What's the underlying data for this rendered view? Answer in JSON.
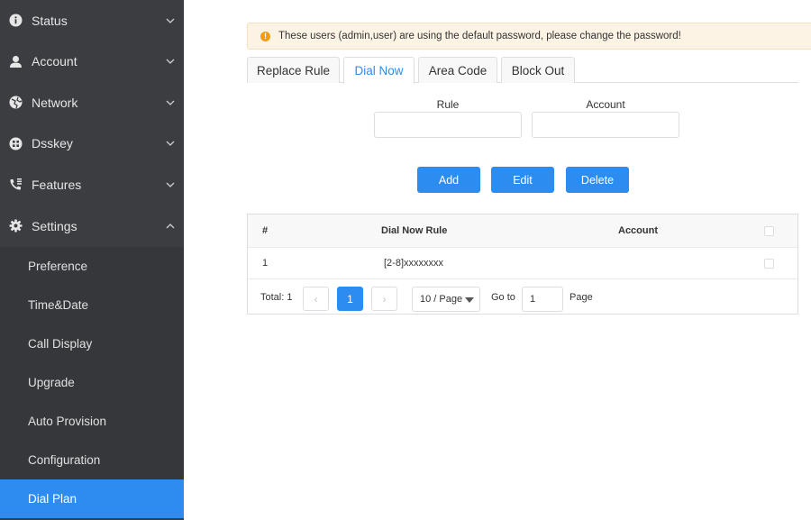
{
  "sidebar": {
    "items": [
      {
        "label": "Status",
        "icon": "info-icon"
      },
      {
        "label": "Account",
        "icon": "user-icon"
      },
      {
        "label": "Network",
        "icon": "globe-icon"
      },
      {
        "label": "Dsskey",
        "icon": "grid-icon"
      },
      {
        "label": "Features",
        "icon": "phone-icon"
      },
      {
        "label": "Settings",
        "icon": "gear-icon"
      }
    ],
    "sub_items": [
      "Preference",
      "Time&Date",
      "Call Display",
      "Upgrade",
      "Auto Provision",
      "Configuration",
      "Dial Plan"
    ],
    "active": "Dial Plan"
  },
  "warning": {
    "text": "These users (admin,user) are using the default password, please change the password!",
    "icon_char": "!"
  },
  "tabs": [
    "Replace Rule",
    "Dial Now",
    "Area Code",
    "Block Out"
  ],
  "active_tab": "Dial Now",
  "form": {
    "rule_label": "Rule",
    "rule_value": "",
    "account_label": "Account",
    "account_value": ""
  },
  "buttons": {
    "add": "Add",
    "edit": "Edit",
    "delete": "Delete"
  },
  "table": {
    "columns": [
      "#",
      "Dial Now Rule",
      "Account"
    ],
    "rows": [
      {
        "num": "1",
        "rule": "[2-8]xxxxxxxx",
        "account": ""
      }
    ]
  },
  "pagination": {
    "total": "Total: 1",
    "prev": "‹",
    "current": "1",
    "next": "›",
    "page_size": "10 / Page",
    "goto_label": "Go to",
    "goto_value": "1",
    "page_label": "Page"
  },
  "colors": {
    "accent": "#2d8cf0",
    "sidebar_bg": "#3b3d40",
    "warning_bg": "#fdf3e5"
  }
}
